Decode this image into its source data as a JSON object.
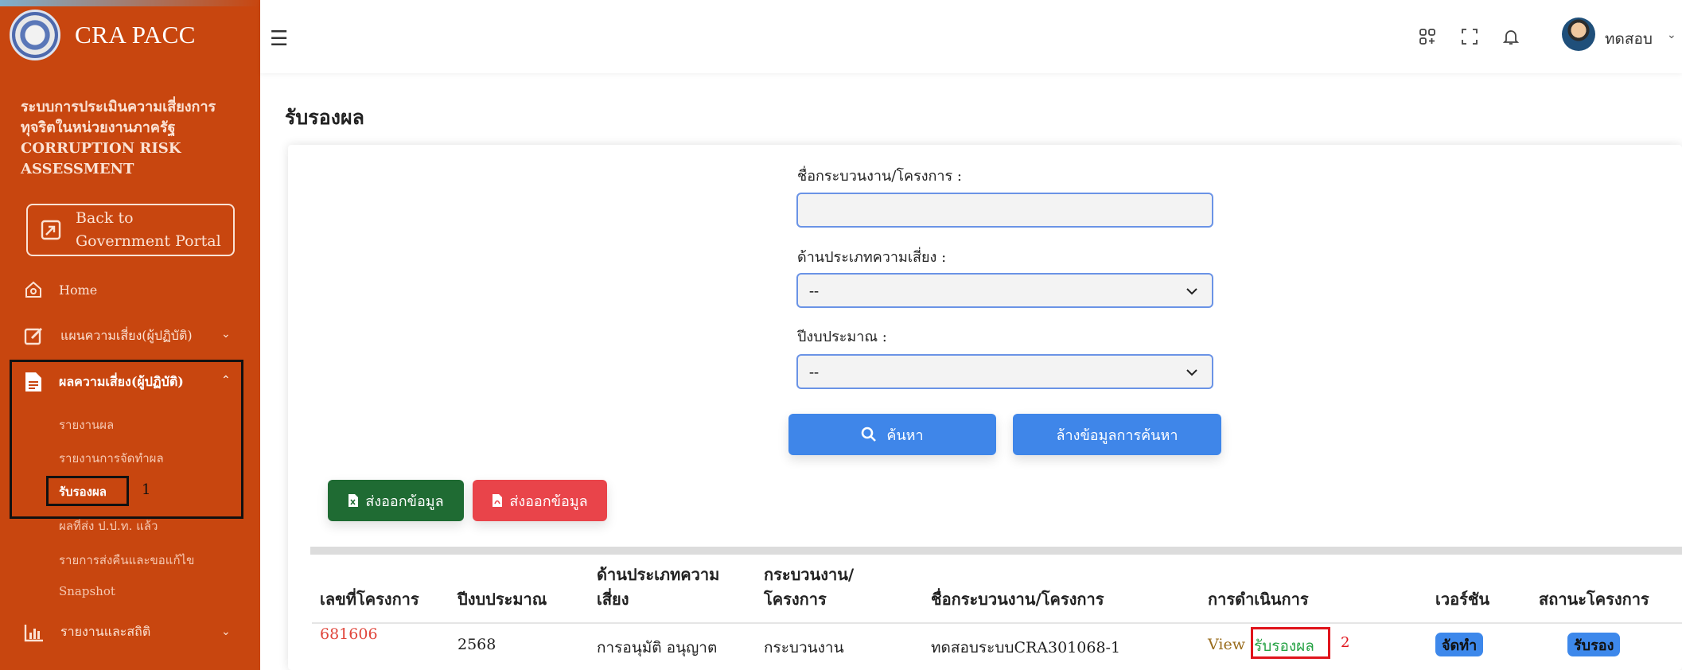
{
  "brand": {
    "name": "CRA PACC"
  },
  "sidebar": {
    "system_title": "ระบบการประเมินความเสี่ยงการทุจริตในหน่วยงานภาครัฐ CORRUPTION RISK ASSESSMENT",
    "back_button_line1": "Back to",
    "back_button_line2": "Government Portal",
    "items": [
      {
        "label": "Home"
      },
      {
        "label": "แผนความเสี่ยง(ผู้ปฏิบัติ)"
      },
      {
        "label": "ผลความเสี่ยง(ผู้ปฏิบัติ)"
      },
      {
        "label": "รายงานและสถิติ"
      }
    ],
    "sub_items": [
      {
        "label": "รายงานผล"
      },
      {
        "label": "รายงานการจัดทำผล"
      },
      {
        "label": "รับรองผล"
      },
      {
        "label": "ผลที่ส่ง ป.ป.ท. แล้ว"
      },
      {
        "label": "รายการส่งคืนและขอแก้ไข"
      },
      {
        "label": "Snapshot"
      }
    ],
    "annotation_number": "1"
  },
  "header": {
    "user_name": "ทดสอบ"
  },
  "page": {
    "title": "รับรองผล"
  },
  "search": {
    "project_name_label": "ชื่อกระบวนงาน/โครงการ :",
    "project_name_value": "",
    "risk_type_label": "ด้านประเภทความเสี่ยง :",
    "risk_type_value": "--",
    "fiscal_year_label": "ปีงบประมาณ :",
    "fiscal_year_value": "--",
    "search_button": "ค้นหา",
    "clear_button": "ล้างข้อมูลการค้นหา"
  },
  "export": {
    "excel_button": "ส่งออกข้อมูล",
    "pdf_button": "ส่งออกข้อมูล"
  },
  "table": {
    "headers": {
      "project_no": "เลขที่โครงการ",
      "fiscal_year": "ปีงบประมาณ",
      "risk_type_1": "ด้านประเภทความ",
      "risk_type_2": "เสี่ยง",
      "process_1": "กระบวนงาน/",
      "process_2": "โครงการ",
      "process_name": "ชื่อกระบวนงาน/โครงการ",
      "action": "การดำเนินการ",
      "version": "เวอร์ชัน",
      "status": "สถานะโครงการ"
    },
    "rows": [
      {
        "project_no": "681606",
        "fiscal_year": "2568",
        "risk_type": "การอนุมัติ อนุญาต",
        "process": "กระบวนงาน",
        "process_name": "ทดสอบระบบCRA301068-1",
        "action_view": "View",
        "action_certify": "รับรองผล",
        "version": "จัดทำ",
        "status": "รับรอง"
      }
    ],
    "annotation_number": "2"
  },
  "colors": {
    "sidebar": "#c8460f",
    "primary": "#3f86e9",
    "excel": "#1f6b33",
    "pdf": "#e9444a"
  }
}
